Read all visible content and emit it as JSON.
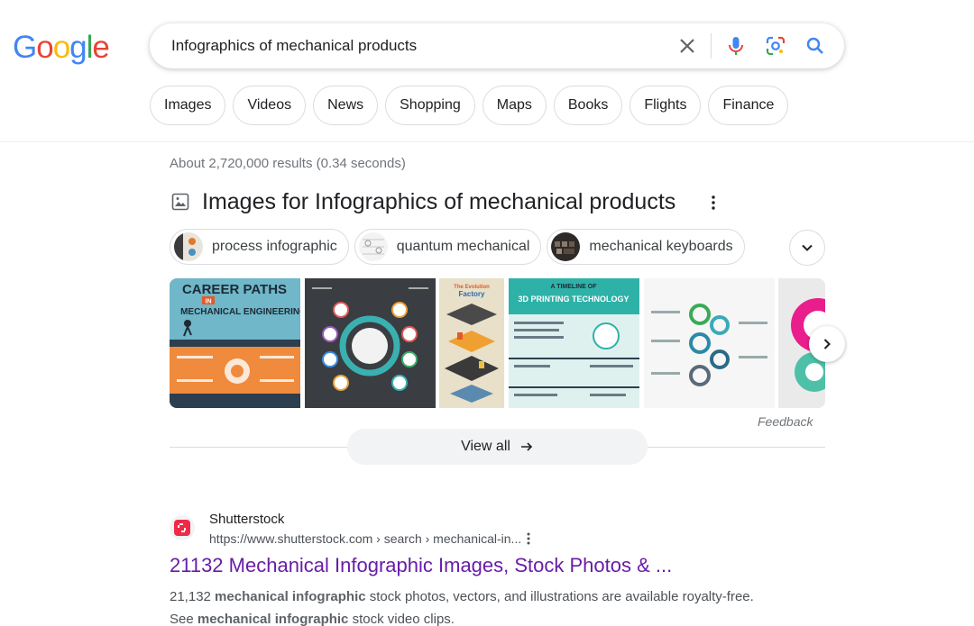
{
  "logo": {
    "letters": [
      "G",
      "o",
      "o",
      "g",
      "l",
      "e"
    ],
    "colors": [
      "#4285F4",
      "#EA4335",
      "#FBBC05",
      "#4285F4",
      "#34A853",
      "#EA4335"
    ]
  },
  "search": {
    "query": "Infographics of mechanical products",
    "icons": [
      "close-icon",
      "microphone-icon",
      "lens-icon",
      "search-icon"
    ]
  },
  "filters": [
    "Images",
    "Videos",
    "News",
    "Shopping",
    "Maps",
    "Books",
    "Flights",
    "Finance"
  ],
  "stats": "About 2,720,000 results (0.34 seconds)",
  "images": {
    "title": "Images for Infographics of mechanical products",
    "refinements": [
      "process infographic",
      "quantum mechanical",
      "mechanical keyboards"
    ],
    "thumbnails": [
      {
        "title": "CAREER PATHS",
        "subtitle": "MECHANICAL ENGINEERING",
        "tag": "IN"
      },
      {
        "title": "",
        "subtitle": ""
      },
      {
        "title": "The Evolution",
        "subtitle": "Factory"
      },
      {
        "title": "A TIMELINE OF",
        "subtitle": "3D PRINTING TECHNOLOGY"
      },
      {
        "title": "",
        "subtitle": ""
      },
      {
        "title": "",
        "subtitle": ""
      }
    ],
    "feedback": "Feedback",
    "view_all": "View all"
  },
  "result": {
    "site": "Shutterstock",
    "url": "https://www.shutterstock.com › search › mechanical-in...",
    "title": "21132 Mechanical Infographic Images, Stock Photos & ...",
    "snippet": {
      "l1a": "21,132 ",
      "l1b": "mechanical infographic",
      "l1c": " stock photos, vectors, and illustrations are available royalty-free.",
      "l2a": "See ",
      "l2b": "mechanical infographic",
      "l2c": " stock video clips."
    },
    "brand_color": "#EE2B47"
  }
}
